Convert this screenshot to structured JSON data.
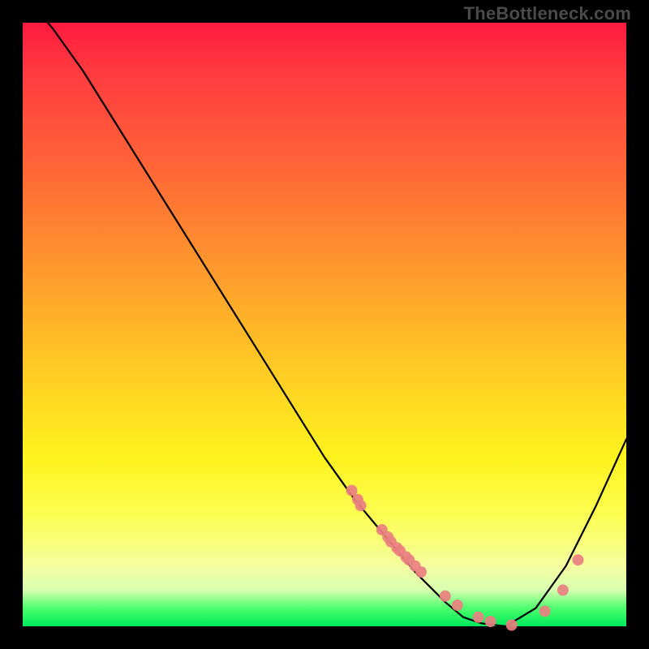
{
  "watermark": "TheBottleneck.com",
  "chart_data": {
    "type": "line",
    "title": "",
    "xlabel": "",
    "ylabel": "",
    "xlim": [
      0,
      1
    ],
    "ylim": [
      0,
      1
    ],
    "grid": false,
    "series": [
      {
        "name": "curve",
        "color": "#000000",
        "x": [
          0.0,
          0.05,
          0.1,
          0.15,
          0.2,
          0.25,
          0.3,
          0.35,
          0.4,
          0.45,
          0.5,
          0.55,
          0.6,
          0.65,
          0.7,
          0.73,
          0.76,
          0.8,
          0.85,
          0.9,
          0.95,
          1.0
        ],
        "y": [
          1.05,
          0.99,
          0.92,
          0.84,
          0.76,
          0.68,
          0.6,
          0.52,
          0.44,
          0.36,
          0.28,
          0.21,
          0.15,
          0.09,
          0.04,
          0.015,
          0.005,
          0.0,
          0.03,
          0.1,
          0.2,
          0.31
        ]
      },
      {
        "name": "dots",
        "color": "#e98080",
        "type_override": "scatter",
        "x": [
          0.545,
          0.555,
          0.56,
          0.595,
          0.605,
          0.61,
          0.62,
          0.625,
          0.635,
          0.64,
          0.65,
          0.66,
          0.7,
          0.72,
          0.755,
          0.775,
          0.81,
          0.865,
          0.895,
          0.92
        ],
        "y": [
          0.225,
          0.21,
          0.2,
          0.16,
          0.148,
          0.14,
          0.13,
          0.125,
          0.115,
          0.11,
          0.1,
          0.09,
          0.05,
          0.035,
          0.015,
          0.008,
          0.002,
          0.025,
          0.06,
          0.11
        ]
      }
    ]
  }
}
